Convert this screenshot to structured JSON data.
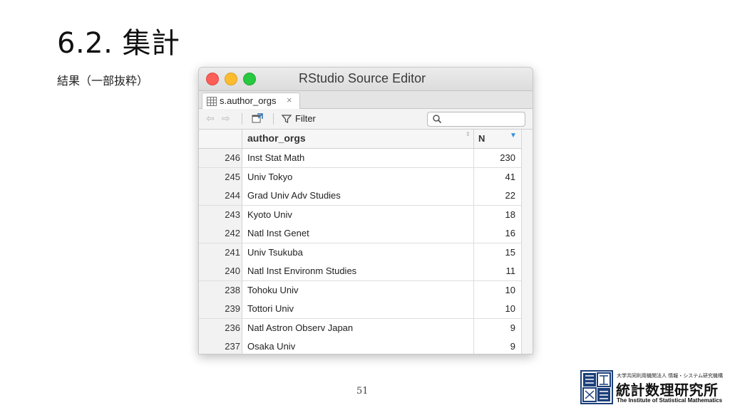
{
  "slide": {
    "title": "6.2. 集計",
    "subtitle": "結果（一部抜粋）",
    "page_number": "51"
  },
  "window": {
    "title": "RStudio Source Editor",
    "tab_label": "s.author_orgs",
    "tab_close": "×",
    "filter_label": "Filter",
    "back_glyph": "⇦",
    "forward_glyph": "⇨"
  },
  "table": {
    "columns": [
      "author_orgs",
      "N"
    ],
    "sort_icon": "⇕",
    "sort_desc_icon": "▼",
    "rows": [
      {
        "id": "246",
        "author_orgs": "Inst Stat Math",
        "n": "230"
      },
      {
        "id": "245",
        "author_orgs": "Univ Tokyo",
        "n": "41"
      },
      {
        "id": "244",
        "author_orgs": "Grad Univ Adv Studies",
        "n": "22"
      },
      {
        "id": "243",
        "author_orgs": "Kyoto Univ",
        "n": "18"
      },
      {
        "id": "242",
        "author_orgs": "Natl Inst Genet",
        "n": "16"
      },
      {
        "id": "241",
        "author_orgs": "Univ Tsukuba",
        "n": "15"
      },
      {
        "id": "240",
        "author_orgs": "Natl Inst Environm Studies",
        "n": "11"
      },
      {
        "id": "238",
        "author_orgs": "Tohoku Univ",
        "n": "10"
      },
      {
        "id": "239",
        "author_orgs": "Tottori Univ",
        "n": "10"
      },
      {
        "id": "236",
        "author_orgs": "Natl Astron Observ Japan",
        "n": "9"
      },
      {
        "id": "237",
        "author_orgs": "Osaka Univ",
        "n": "9"
      }
    ]
  },
  "logo": {
    "top_line": "大学共同利用機関法人 情報・システム研究機構",
    "main": "統計数理研究所",
    "english": "The Institute of Statistical Mathematics"
  },
  "colors": {
    "close": "#fc5f57",
    "minimize": "#fdbc2e",
    "zoom": "#28c840",
    "sort_accent": "#2f8fe0"
  }
}
